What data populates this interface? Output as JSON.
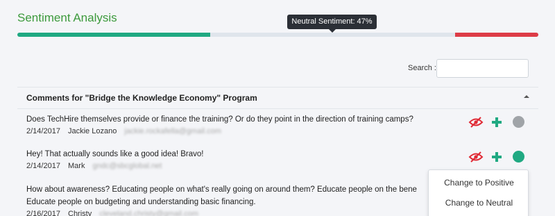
{
  "page": {
    "title": "Sentiment Analysis"
  },
  "tooltip": {
    "text": "Neutral Sentiment: 47%"
  },
  "sentiment_bar": {
    "positive_fraction": 0.37,
    "neutral_fraction": 0.47,
    "negative_fraction": 0.16,
    "colors": {
      "positive": "#20a982",
      "neutral": "#dfe5ec",
      "negative": "#dd3c47"
    }
  },
  "search": {
    "label": "Search :",
    "value": ""
  },
  "panel": {
    "title": "Comments for \"Bridge the Knowledge Economy\" Program",
    "icon": "caret-up-icon"
  },
  "comments": [
    {
      "text": "Does TechHire themselves provide or finance the training? Or do they point in the direction of training camps?",
      "date": "2/14/2017",
      "author": "Jackie Lozano",
      "email": "jackie.rockafella@gmail.com",
      "status_color": "#a0a4a8"
    },
    {
      "text": "Hey! That actually sounds like a good idea! Bravo!",
      "date": "2/14/2017",
      "author": "Mark",
      "email": "gndc@sbcglobal.net",
      "status_color": "#20a982"
    },
    {
      "text_line1": "How about awareness? Educating people on what's really going on around them? Educate people on the bene",
      "text_line2": "Educate people on budgeting and understanding basic financing.",
      "date": "2/16/2017",
      "author": "Christy",
      "email": "cleveland.christy@gmail.com"
    }
  ],
  "actions": {
    "hide_icon": "eye-slash-icon",
    "add_icon": "plus-icon",
    "status_icon": "status-dot-icon"
  },
  "menu": {
    "items": [
      "Change to Positive",
      "Change to Neutral"
    ]
  },
  "colors": {
    "accent_green": "#20a982",
    "hide_red": "#e02b36",
    "title_green": "#3c9a3c"
  }
}
